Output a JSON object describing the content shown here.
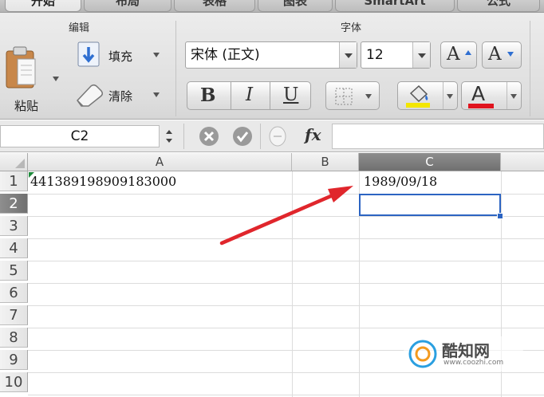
{
  "ribbon_tabs": [
    {
      "label": "开始",
      "active": true
    },
    {
      "label": "布局",
      "active": false
    },
    {
      "label": "表格",
      "active": false
    },
    {
      "label": "图表",
      "active": false
    },
    {
      "label": "SmartArt",
      "active": false
    },
    {
      "label": "公式",
      "active": false
    }
  ],
  "groups": {
    "edit_title": "编辑",
    "font_title": "字体"
  },
  "edit": {
    "paste_label": "粘贴",
    "fill_label": "填充",
    "clear_label": "清除"
  },
  "font": {
    "font_name": "宋体 (正文)",
    "font_size": "12",
    "bold": "B",
    "italic": "I",
    "underline": "U",
    "font_color_glyph": "A",
    "increase_size_glyph": "A",
    "decrease_size_glyph": "A",
    "highlight_color": "#f3e600",
    "font_color": "#e0141e"
  },
  "formula_bar": {
    "name_box": "C2",
    "fx_label": "fx",
    "formula_value": ""
  },
  "sheet": {
    "columns": [
      "A",
      "B",
      "C"
    ],
    "rows": [
      "1",
      "2",
      "3",
      "4",
      "5",
      "6",
      "7",
      "8",
      "9",
      "10"
    ],
    "selected_cell": "C2",
    "cells": {
      "A1": "441389198909183000",
      "C1": "1989/09/18"
    }
  },
  "annotation_arrow_color": "#e0262c",
  "watermark": {
    "brand": "酷知网",
    "url": "www.coozhi.com"
  }
}
